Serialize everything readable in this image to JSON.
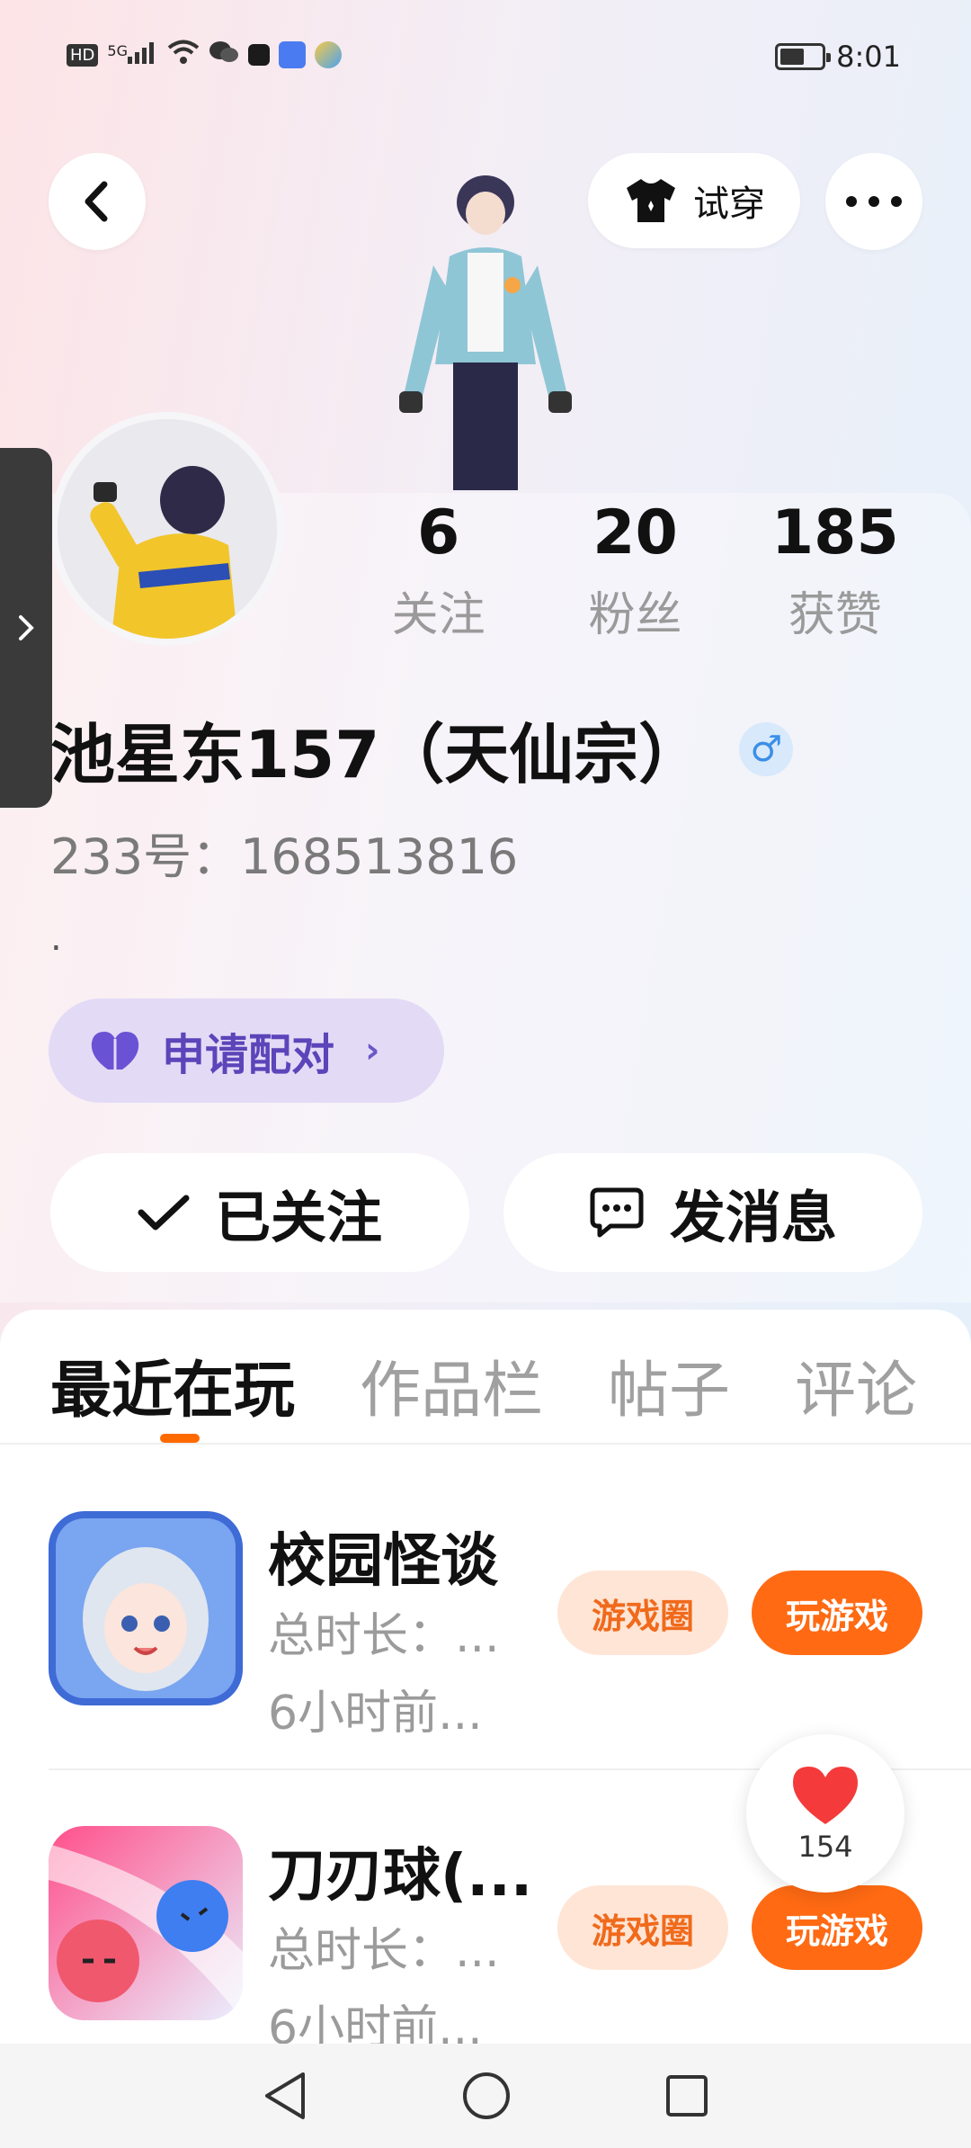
{
  "status_bar": {
    "left_icons": [
      "hd-icon",
      "signal-5g-icon",
      "wifi-icon",
      "wechat-icon",
      "app-icon",
      "app-icon-2",
      "app-icon-3"
    ],
    "hd_label": "HD",
    "network_label": "5G",
    "time": "8:01"
  },
  "header": {
    "try_on_label": "试穿"
  },
  "profile": {
    "name": "池星东157（天仙宗）",
    "gender_symbol": "♂",
    "uid_label": "233号：168513816",
    "bio": ".",
    "stats": [
      {
        "value": "6",
        "label": "关注"
      },
      {
        "value": "20",
        "label": "粉丝"
      },
      {
        "value": "185",
        "label": "获赞"
      }
    ],
    "pair_label": "申请配对",
    "followed_label": "已关注",
    "message_label": "发消息"
  },
  "tabs": [
    {
      "label": "最近在玩",
      "active": true
    },
    {
      "label": "作品栏",
      "active": false
    },
    {
      "label": "帖子",
      "active": false
    },
    {
      "label": "评论",
      "active": false
    }
  ],
  "games": [
    {
      "title": "校园怪谈",
      "duration": "总时长：...",
      "last_played": "6小时前...",
      "circle_label": "游戏圈",
      "play_label": "玩游戏"
    },
    {
      "title": "刀刃球(...",
      "duration": "总时长：...",
      "last_played": "6小时前...",
      "circle_label": "游戏圈",
      "play_label": "玩游戏"
    }
  ],
  "like_fab": {
    "count": "154"
  },
  "colors": {
    "accent_orange": "#ff6a13",
    "pair_purple": "#5a45b9",
    "gender_blue": "#3b8fe6"
  }
}
